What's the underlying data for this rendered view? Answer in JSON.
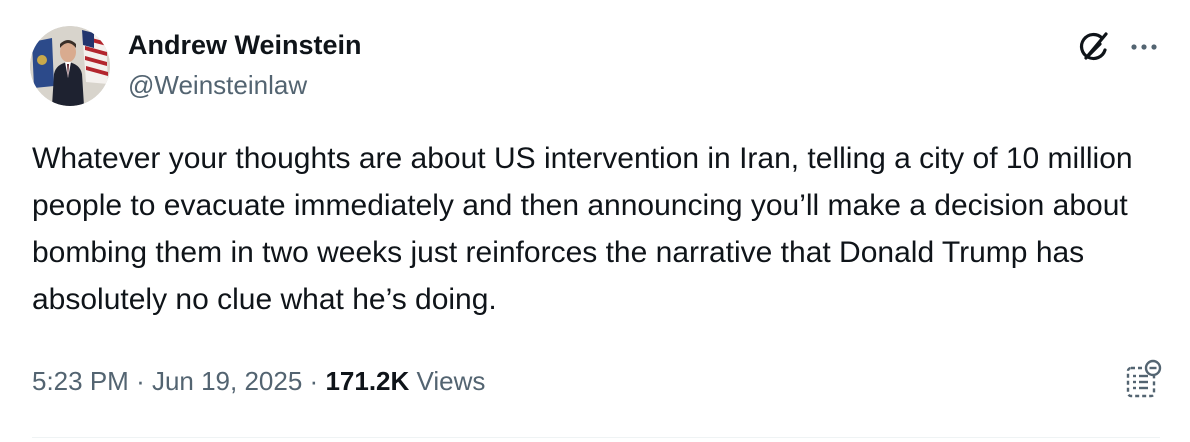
{
  "author": {
    "display_name": "Andrew Weinstein",
    "handle": "@Weinsteinlaw"
  },
  "tweet": {
    "text": "Whatever your thoughts are about US intervention in Iran, telling a city of 10 million people to evacuate immediately and then announcing you’ll make a decision about bombing them in two weeks just reinforces the narrative that Donald Trump has absolutely no clue what he’s doing."
  },
  "meta": {
    "time": "5:23 PM",
    "separator": "·",
    "date": "Jun 19, 2025",
    "views_count": "171.2K",
    "views_label": "Views"
  },
  "icons": {
    "grok": "grok-icon",
    "more": "more-icon",
    "summary": "summary-icon"
  },
  "colors": {
    "text_primary": "#0f1419",
    "text_secondary": "#536471",
    "divider": "#eff3f4"
  }
}
